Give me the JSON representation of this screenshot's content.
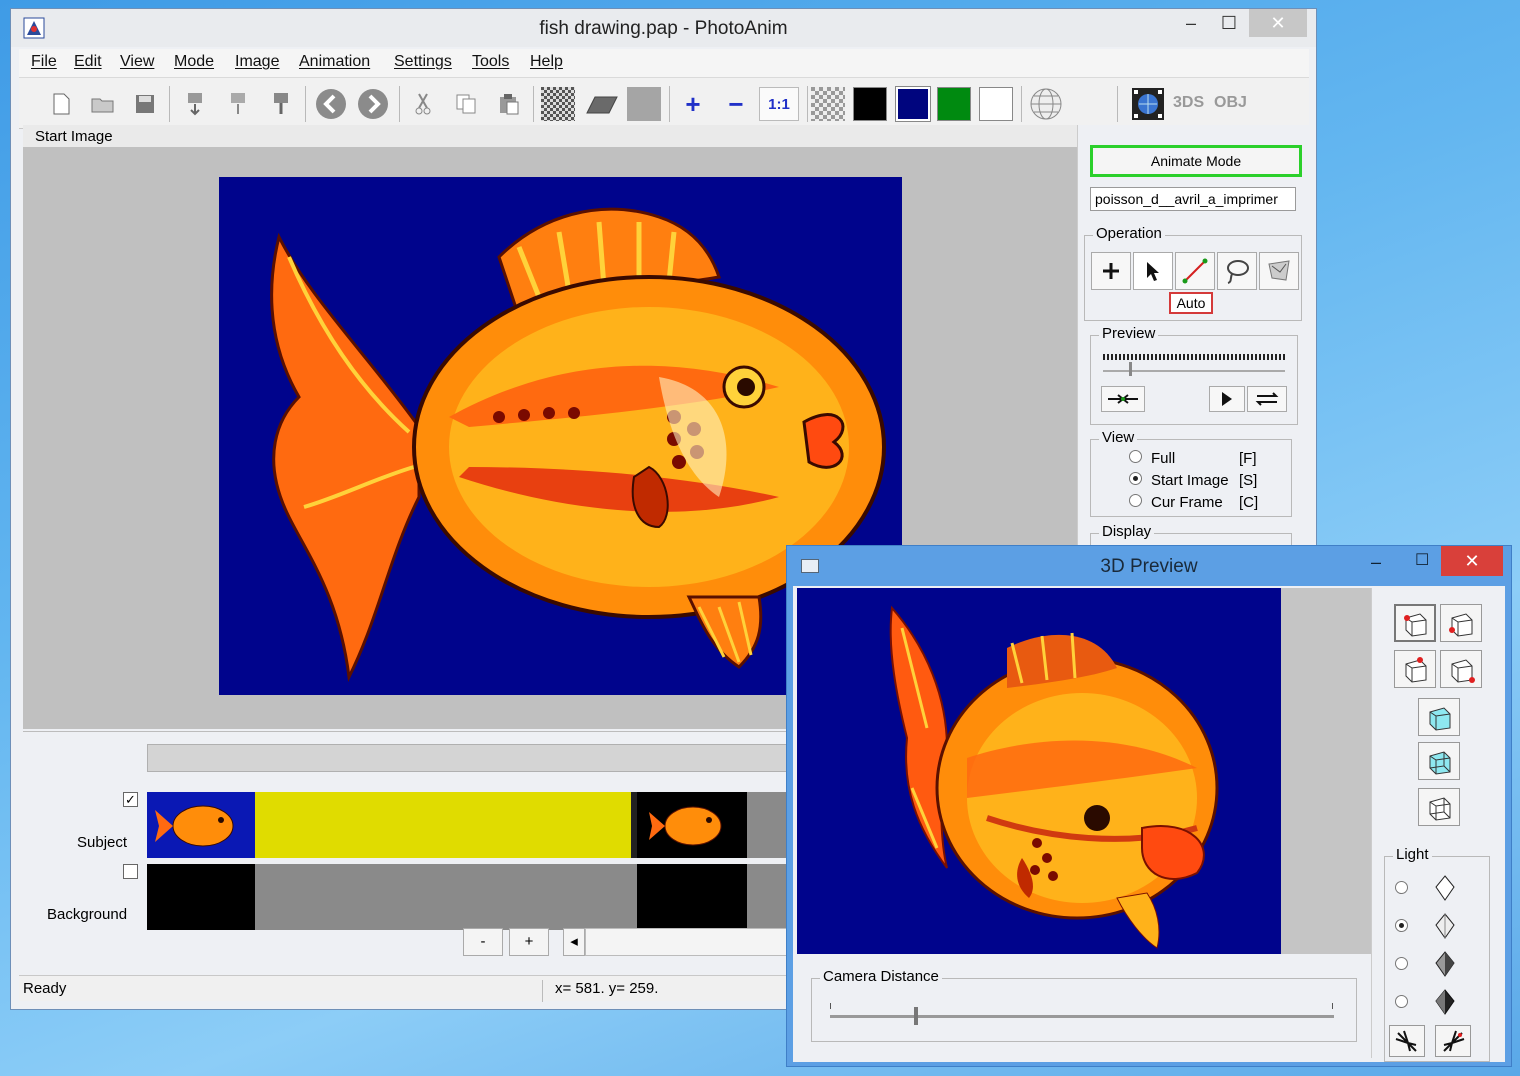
{
  "main_window": {
    "title": "fish drawing.pap - PhotoAnim",
    "minimize": "–",
    "maximize": "☐",
    "close": "✕"
  },
  "menu": [
    "File",
    "Edit",
    "View",
    "Mode",
    "Image",
    "Animation",
    "Settings",
    "Tools",
    "Help"
  ],
  "toolbar": {
    "icons": [
      "new-file-icon",
      "open-folder-icon",
      "save-icon",
      "insert-down-icon",
      "insert-up-icon",
      "pin-icon",
      "back-arrow-icon",
      "forward-arrow-icon",
      "cut-icon",
      "copy-icon",
      "paste-icon",
      "checker-pattern-icon",
      "plane-icon",
      "gray-square-icon",
      "zoom-in-icon",
      "zoom-out-icon",
      "checker-swatch-icon",
      "globe-grid-icon",
      "film-globe-icon"
    ],
    "zoom_in": "+",
    "zoom_out": "−",
    "zoom_reset": "1:1",
    "swatches": [
      "#000000",
      "#00057e",
      "#008a10",
      "#ffffff"
    ],
    "export_3ds": "3DS",
    "export_obj": "OBJ"
  },
  "canvas": {
    "label": "Start Image"
  },
  "right_panel": {
    "mode_button": "Animate Mode",
    "file_name": "poisson_d__avril_a_imprimer",
    "operation": {
      "title": "Operation",
      "tools": [
        "add-point-icon",
        "select-arrow-icon",
        "draw-line-icon",
        "lasso-icon",
        "warp-icon"
      ],
      "auto": "Auto"
    },
    "preview": {
      "title": "Preview",
      "buttons": [
        "step-icon",
        "play-icon",
        "loop-icon"
      ]
    },
    "view": {
      "title": "View",
      "options": [
        {
          "label": "Full",
          "key": "[F]",
          "selected": false
        },
        {
          "label": "Start Image",
          "key": "[S]",
          "selected": true
        },
        {
          "label": "Cur Frame",
          "key": "[C]",
          "selected": false
        }
      ]
    },
    "display": {
      "title": "Display"
    }
  },
  "timeline": {
    "tracks": [
      {
        "label": "Subject",
        "checked": true
      },
      {
        "label": "Background",
        "checked": false
      }
    ],
    "minus": "-",
    "plus": "+",
    "scroll_left": "◂"
  },
  "status": {
    "ready": "Ready",
    "coords": "x= 581. y= 259."
  },
  "preview_window": {
    "title": "3D Preview",
    "minimize": "–",
    "maximize": "☐",
    "close": "✕",
    "camera_distance": "Camera Distance",
    "camera_distance_level": 0.17,
    "light": {
      "title": "Light",
      "selected_index": 1
    },
    "cube_buttons": [
      "cube-view-1-icon",
      "cube-view-2-icon",
      "cube-view-3-icon",
      "cube-view-4-icon",
      "cube-front-icon",
      "cube-side-icon",
      "cube-wire-icon"
    ]
  },
  "colors": {
    "image_background": "#00048c",
    "active_mode_border": "#2bd02b",
    "auto_border": "#d43a3a",
    "subject_track": "#e0dc00",
    "close_button": "#d9403a"
  }
}
